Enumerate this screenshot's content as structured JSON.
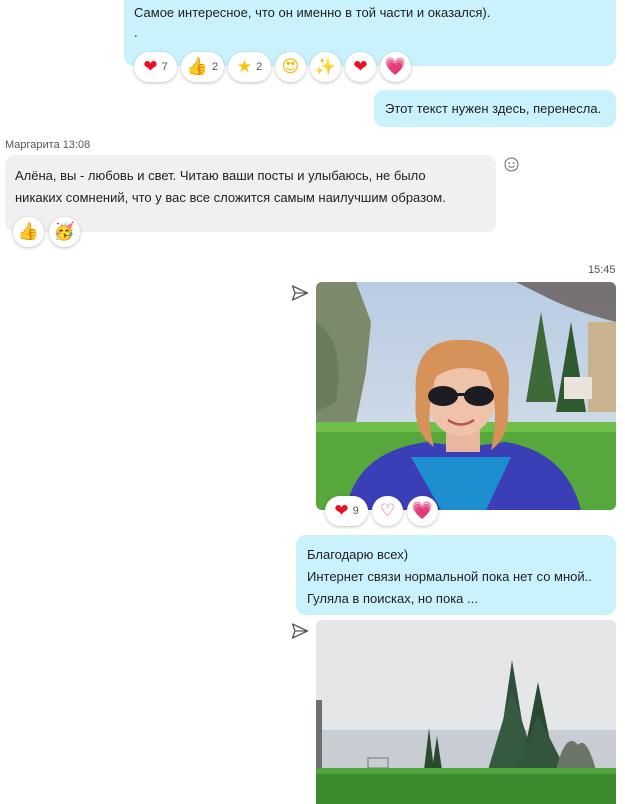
{
  "messages": {
    "m1": {
      "text_line1": "Самое интересное, что он именно в той части и оказался).",
      "text_line2": ".",
      "reactions": [
        {
          "icon": "heart-icon",
          "glyph": "❤",
          "count": "7"
        },
        {
          "icon": "thumbs-up-icon",
          "glyph": "👍",
          "count": "2"
        },
        {
          "icon": "star-icon",
          "glyph": "⭐",
          "count": "2"
        },
        {
          "icon": "heart-eyes-icon",
          "glyph": "😍",
          "count": ""
        },
        {
          "icon": "sparkle-icon",
          "glyph": "✨",
          "count": ""
        },
        {
          "icon": "red-heart-icon",
          "glyph": "❤",
          "count": ""
        },
        {
          "icon": "pink-heart-icon",
          "glyph": "💗",
          "count": ""
        }
      ]
    },
    "m2": {
      "text": "Этот текст нужен здесь, перенесла."
    },
    "m3": {
      "sender": "Маргарита 13:08",
      "text_line1": "Алёна, вы - любовь и свет. Читаю ваши посты и улыбаюсь, не было",
      "text_line2": "никаких сомнений, что у вас все сложится самым наилучшим образом.",
      "reactions": [
        {
          "icon": "thumbs-up-icon",
          "glyph": "👍"
        },
        {
          "icon": "party-face-icon",
          "glyph": "🥳"
        }
      ]
    },
    "time_divider": "15:45",
    "m4": {
      "reactions": [
        {
          "icon": "heart-icon",
          "glyph": "❤",
          "count": "9"
        },
        {
          "icon": "heart-outline-icon",
          "glyph": "♡",
          "count": ""
        },
        {
          "icon": "pink-heart-icon",
          "glyph": "💗",
          "count": ""
        }
      ]
    },
    "m5": {
      "line1": "Благодарю всех)",
      "line2": "Интернет связи нормальной пока нет со мной..",
      "line3": "Гуляла в поисках, но пока ..."
    }
  },
  "colors": {
    "outgoing_bubble": "#c9f2fc",
    "incoming_bubble": "#f0f0f0",
    "heart": "#e81224",
    "pink": "#e8398f"
  }
}
